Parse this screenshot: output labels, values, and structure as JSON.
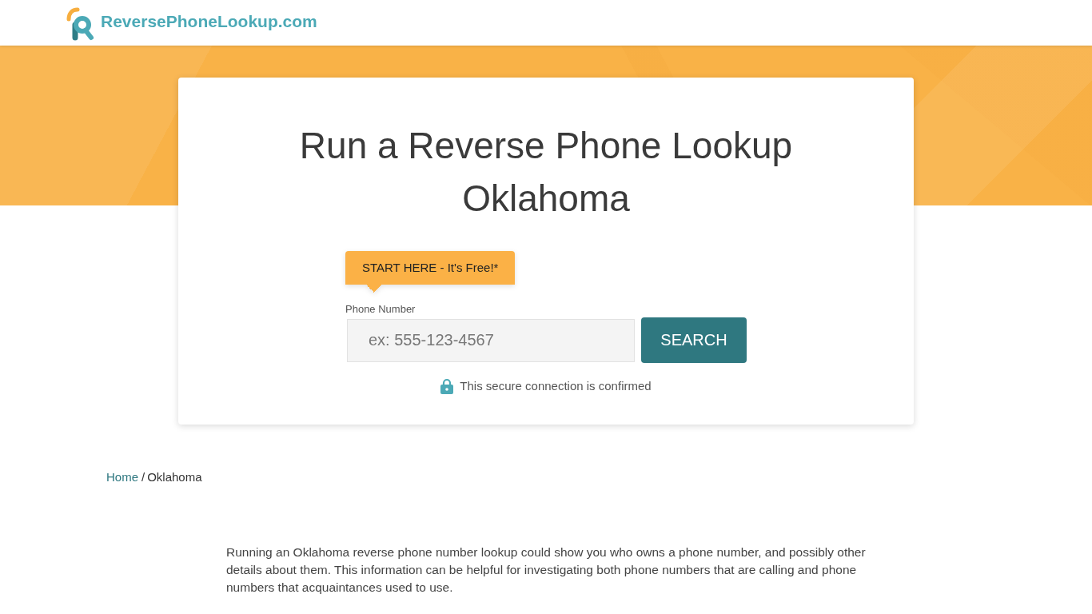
{
  "header": {
    "logo_text": "ReversePhoneLookup.com"
  },
  "search_card": {
    "title": "Run a Reverse Phone Lookup Oklahoma",
    "callout": "START HERE - It's Free!*",
    "phone_field": {
      "label": "Phone Number",
      "placeholder": "ex: 555-123-4567"
    },
    "search_button": "SEARCH",
    "secure_note": "This secure connection is confirmed"
  },
  "breadcrumb": {
    "separator": "/",
    "items": [
      {
        "label": "Home",
        "kind": "link"
      },
      {
        "label": "Oklahoma",
        "kind": "current"
      }
    ]
  },
  "paragraphs": [
    "Running an Oklahoma reverse phone number lookup could show you who owns a phone number, and possibly other details about them. This information can be helpful for investigating both phone numbers that are calling and phone numbers that acquaintances used to use."
  ]
}
